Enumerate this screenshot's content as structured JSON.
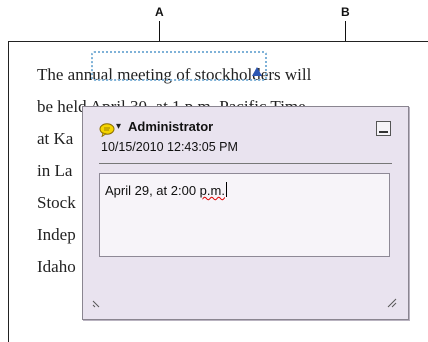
{
  "callouts": {
    "a": "A",
    "b": "B"
  },
  "document": {
    "line1": "The annual meeting of stockholders will",
    "line2_before": "be held ",
    "line2_strike": "April 30, at 1 p.m.",
    "line2_after": " Pacific Time",
    "line3": "at Ka",
    "line4": "in La",
    "line5": "Stock",
    "line6": "Indep",
    "line7": "Idaho"
  },
  "note": {
    "author": "Administrator",
    "timestamp": "10/15/2010 12:43:05 PM",
    "text_before": "April 29, at 2:00 ",
    "text_misspelled": "p.m.",
    "icon": "speech-bubble-icon",
    "colors": {
      "background": "#e9e3ef",
      "icon_fill": "#f5d400",
      "highlight_border": "#7fb2d8"
    }
  }
}
